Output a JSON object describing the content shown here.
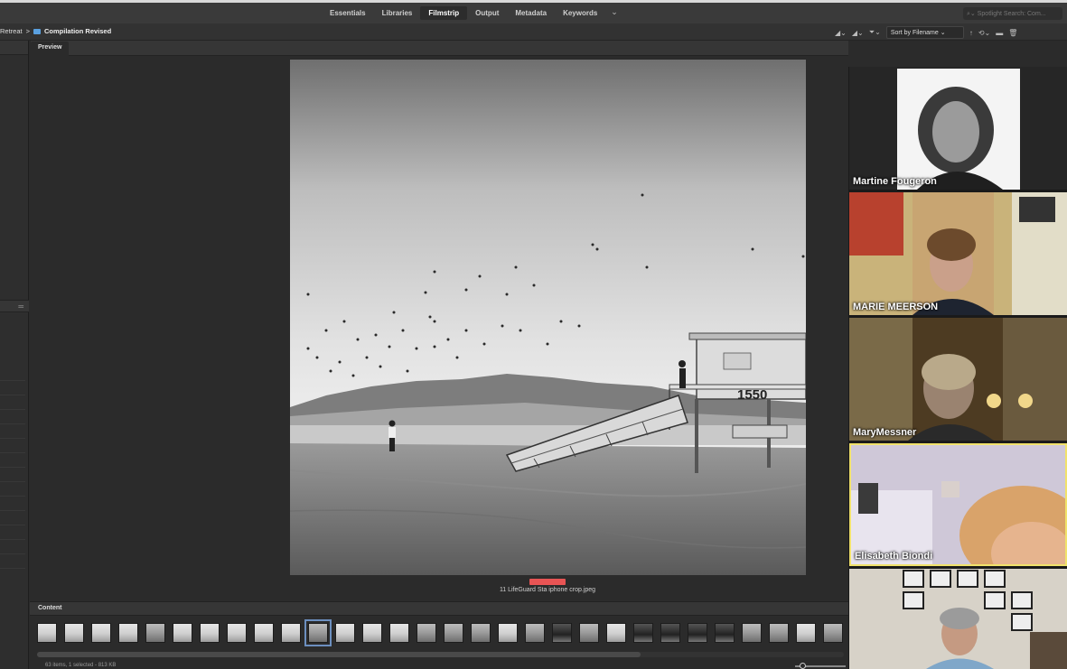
{
  "workspace": {
    "tabs": [
      {
        "label": "Essentials"
      },
      {
        "label": "Libraries"
      },
      {
        "label": "Filmstrip"
      },
      {
        "label": "Output"
      },
      {
        "label": "Metadata"
      },
      {
        "label": "Keywords"
      }
    ],
    "active_tab": "Filmstrip",
    "more_icon": "chevron-down-icon",
    "search_placeholder": "Spotlight Search: Com..."
  },
  "path": {
    "parent": "Retreat",
    "separator": ">",
    "current": "Compilation Revised",
    "folder_color": "#5aa0e0"
  },
  "toolbar": {
    "sort_label": "Sort by Filename",
    "sort_arrow": "↑"
  },
  "preview": {
    "tab_label": "Preview",
    "label_color": "#e85454",
    "filename": "11 LifeGuard Sta iphone crop.jpeg",
    "tower_number": "1550"
  },
  "content": {
    "tab_label": "Content",
    "status": "63 items, 1 selected - 813 KB",
    "selected_index": 10
  },
  "participants": [
    {
      "name": "Martine Fougeron",
      "active": false
    },
    {
      "name": "MARIE MEERSON",
      "active": false
    },
    {
      "name": "MaryMessner",
      "active": false
    },
    {
      "name": "Elisabeth Biondi",
      "active": true
    },
    {
      "name": "",
      "active": false
    }
  ],
  "active_speaker_color": "#f1e26b"
}
